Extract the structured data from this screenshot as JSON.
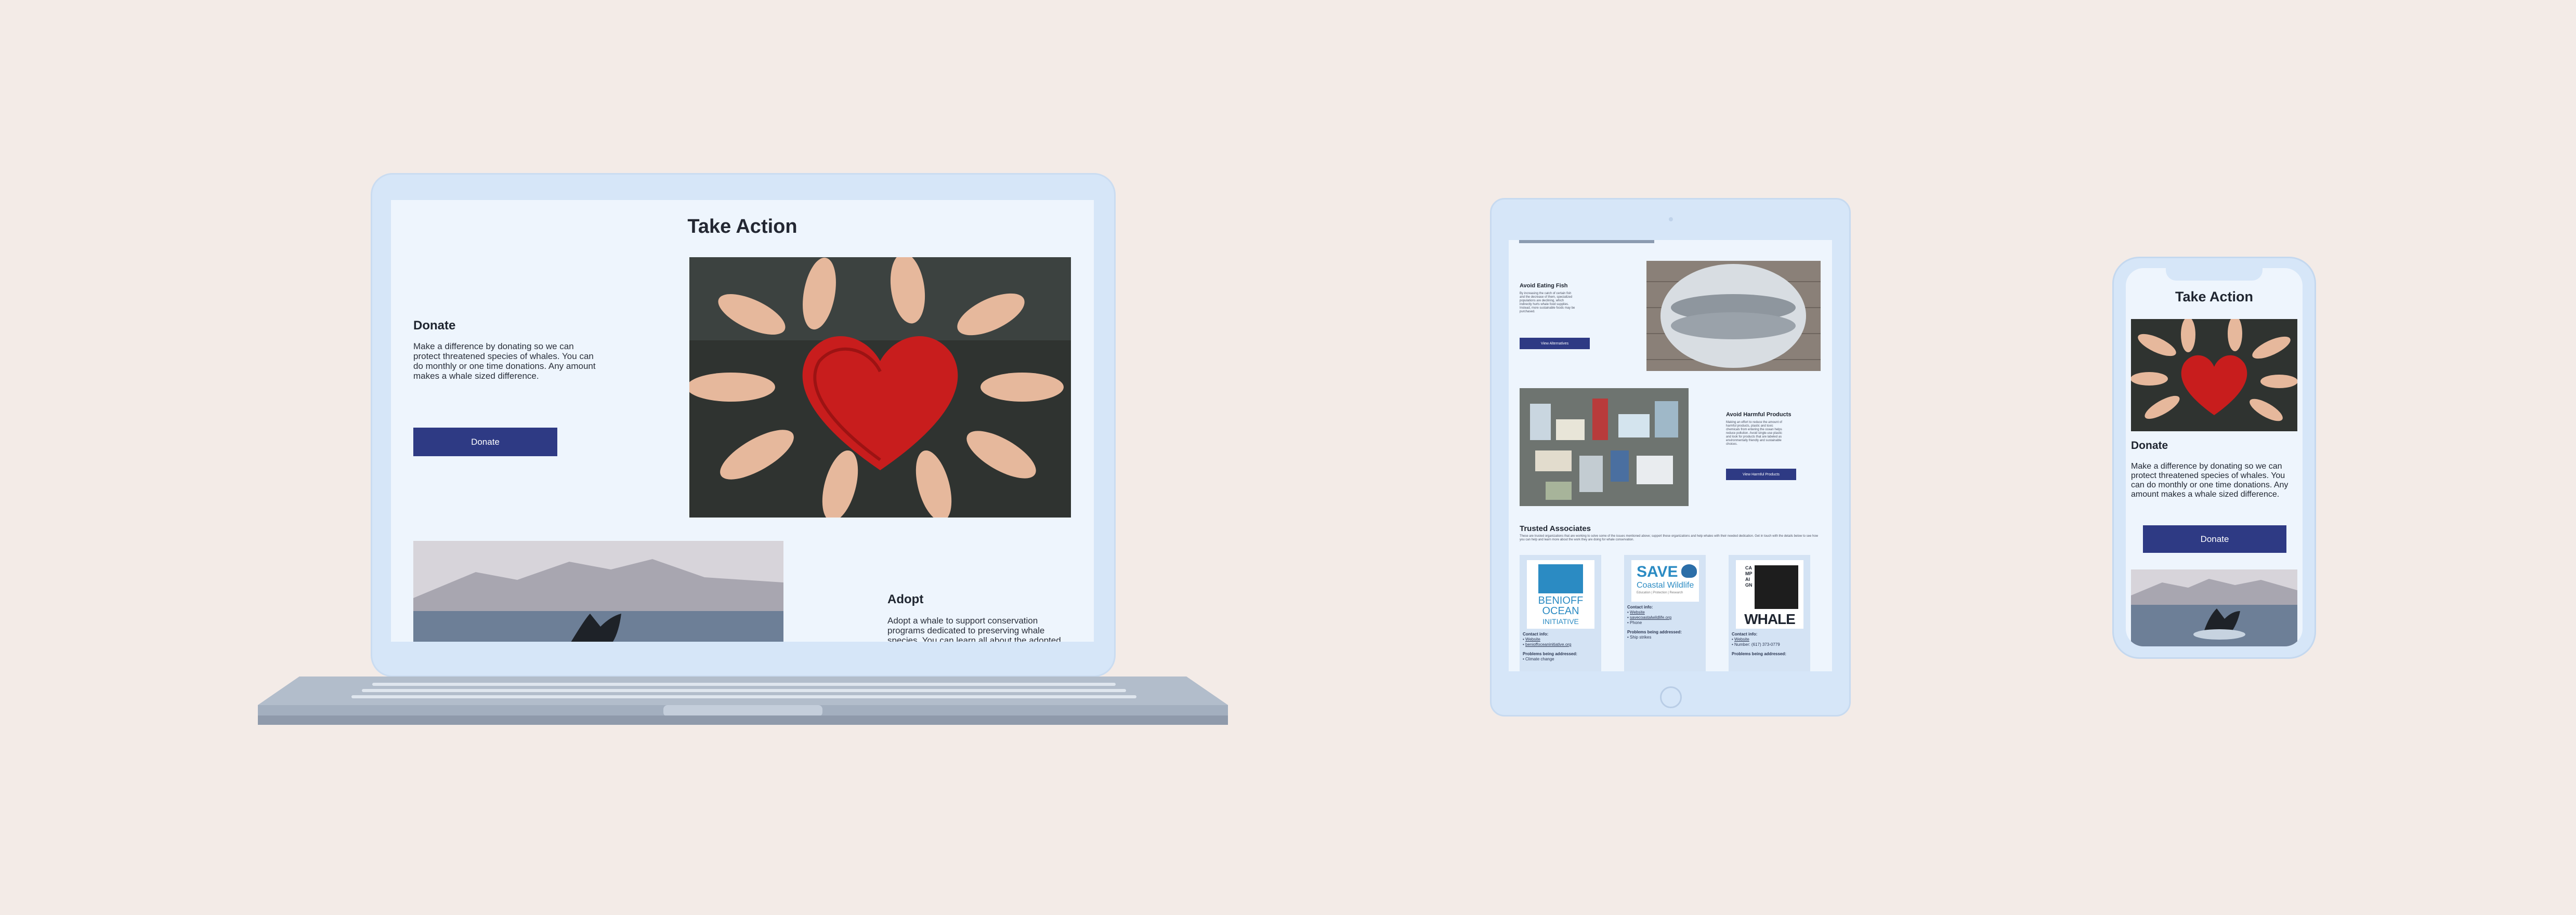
{
  "colors": {
    "background": "#f3ebe7",
    "device": "#d6e6f8",
    "screen": "#eef5fd",
    "accent": "#2e3a84"
  },
  "laptop": {
    "title": "Take Action",
    "donate": {
      "heading": "Donate",
      "text": "Make a difference by donating so we can protect threatened species of whales. You can do monthly or one time donations. Any amount makes a whale sized difference.",
      "button": "Donate"
    },
    "adopt": {
      "heading": "Adopt",
      "text": "Adopt a whale to support conservation programs dedicated to preserving whale species. You can learn all about the adopted whale such as their"
    }
  },
  "tablet": {
    "fish": {
      "heading": "Avoid Eating Fish",
      "text": "By increasing the catch of certain fish and the decrease of them, specialized populations are declining, which indirectly hurts whale food supplies. Instead, more sustainable foods may be purchased.",
      "button": "View Alternatives"
    },
    "products": {
      "heading": "Avoid Harmful Products",
      "text": "Making an effort to reduce the amount of harmful products, plastic and toxic chemicals from entering the ocean helps reduce pollution. Avoid single-use plastic and look for products that are labeled as environmentally friendly and sustainable choices.",
      "button": "View Harmful Products"
    },
    "associates": {
      "heading": "Trusted Associates",
      "text": "These are trusted organizations that are working to solve some of the issues mentioned above; support these organizations and help whales with their needed dedication. Get in touch with the details below to see how you can help and learn more about the work they are doing for whale conservation.",
      "cards": [
        {
          "logo_lines": [
            "BENIOFF",
            "OCEAN",
            "INITIATIVE"
          ],
          "contact_label": "Contact info:",
          "contact_items": [
            "Website",
            "benioffoceaninitiative.org"
          ],
          "problems_label": "Problems being addressed:",
          "problems": [
            "Climate change"
          ]
        },
        {
          "logo_lines": [
            "SAVE",
            "Coastal Wildlife",
            "Education | Protection | Research"
          ],
          "contact_label": "Contact info:",
          "contact_items": [
            "Website",
            "savecoastalwildlife.org",
            "Phone"
          ],
          "problems_label": "Problems being addressed:",
          "problems": [
            "Ship strikes"
          ]
        },
        {
          "logo_lines": [
            "CAMPAIGN",
            "WHALE"
          ],
          "contact_label": "Contact info:",
          "contact_items": [
            "Website",
            "Number: (617) 373-0779"
          ],
          "problems_label": "Problems being addressed:",
          "problems": []
        }
      ]
    }
  },
  "phone": {
    "title": "Take Action",
    "donate": {
      "heading": "Donate",
      "text": "Make a difference by donating so we can protect threatened species of whales. You can do monthly or one time donations. Any amount makes a whale sized difference.",
      "button": "Donate"
    }
  }
}
